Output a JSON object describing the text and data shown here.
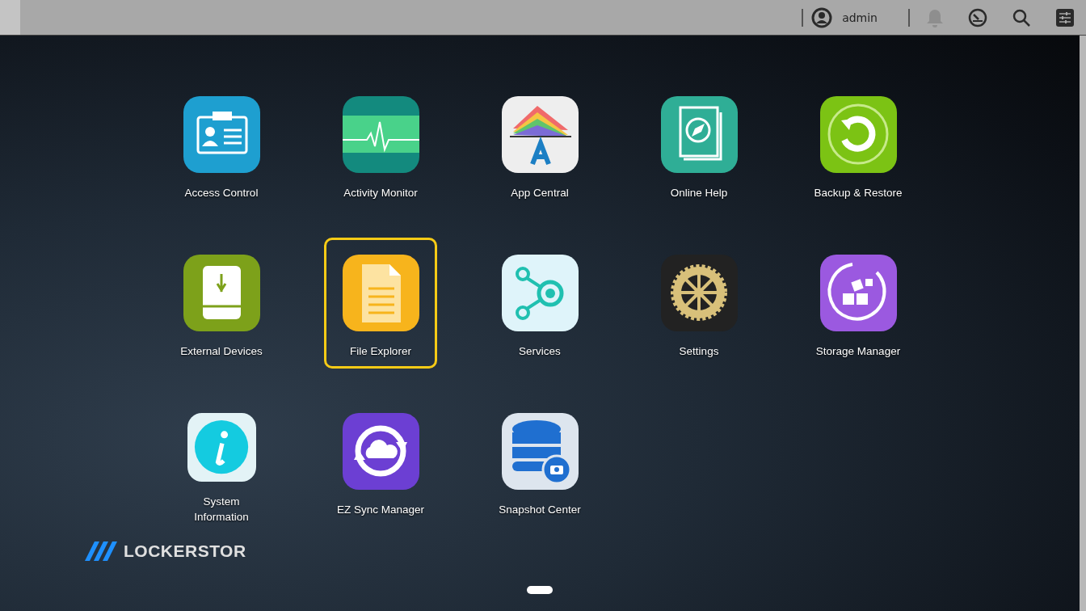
{
  "top_bar": {
    "user": "admin"
  },
  "apps": [
    {
      "kind": "access",
      "label": [
        "Access Control"
      ],
      "selected": false
    },
    {
      "kind": "activity",
      "label": [
        "Activity Monitor"
      ],
      "selected": false
    },
    {
      "kind": "appcentral",
      "label": [
        "App Central"
      ],
      "selected": false
    },
    {
      "kind": "help",
      "label": [
        "Online Help"
      ],
      "selected": false
    },
    {
      "kind": "backup",
      "label": [
        "Backup & Restore"
      ],
      "selected": false
    },
    {
      "kind": "external",
      "label": [
        "External Devices"
      ],
      "selected": false
    },
    {
      "kind": "files",
      "label": [
        "File Explorer"
      ],
      "selected": true
    },
    {
      "kind": "services",
      "label": [
        "Services"
      ],
      "selected": false
    },
    {
      "kind": "settings",
      "label": [
        "Settings"
      ],
      "selected": false
    },
    {
      "kind": "storage",
      "label": [
        "Storage Manager"
      ],
      "selected": false
    },
    {
      "kind": "sysinfo",
      "label": [
        "System",
        "Information"
      ],
      "selected": false
    },
    {
      "kind": "ezsync",
      "label": [
        "EZ Sync Manager"
      ],
      "selected": false
    },
    {
      "kind": "snapshot",
      "label": [
        "Snapshot Center"
      ],
      "selected": false
    }
  ],
  "logo": {
    "text": "LOCKERSTOR"
  }
}
